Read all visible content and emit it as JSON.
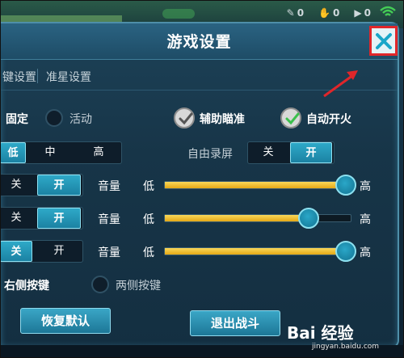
{
  "window": {
    "title": "游戏设置"
  },
  "tabs": [
    {
      "label": "键设置"
    },
    {
      "label": "准星设置"
    }
  ],
  "row1": {
    "fixed_label": "固定",
    "active_label": "活动",
    "assist_aim_label": "辅助瞄准",
    "auto_fire_label": "自动开火"
  },
  "row2": {
    "quality_options": [
      "低",
      "中",
      "高"
    ],
    "quality_selected": "低",
    "record_label": "自由录屏",
    "record_options": [
      "关",
      "开"
    ],
    "record_selected": "开"
  },
  "sliders": [
    {
      "toggle_options": [
        "关",
        "开"
      ],
      "toggle_selected": "开",
      "volume_label": "音量",
      "low_label": "低",
      "high_label": "高",
      "value": 1.0
    },
    {
      "toggle_options": [
        "关",
        "开"
      ],
      "toggle_selected": "开",
      "volume_label": "音量",
      "low_label": "低",
      "high_label": "高",
      "value": 0.77
    },
    {
      "toggle_options": [
        "关",
        "开"
      ],
      "toggle_selected": "关",
      "volume_label": "音量",
      "low_label": "低",
      "high_label": "高",
      "value": 1.0
    }
  ],
  "buttons_row": {
    "right_label": "右侧按键",
    "both_label": "两侧按键"
  },
  "footer": {
    "reset_label": "恢复默认",
    "exit_label": "退出战斗"
  },
  "hud": {
    "icon1_value": "0",
    "icon2_value": "0",
    "icon3_value": "0"
  },
  "watermark": {
    "brand": "Bai 经验",
    "url": "jingyan.baidu.com"
  },
  "colors": {
    "accent": "#2ea9c8",
    "slider_fill": "#f1c232",
    "highlight_box": "#e0262a"
  }
}
